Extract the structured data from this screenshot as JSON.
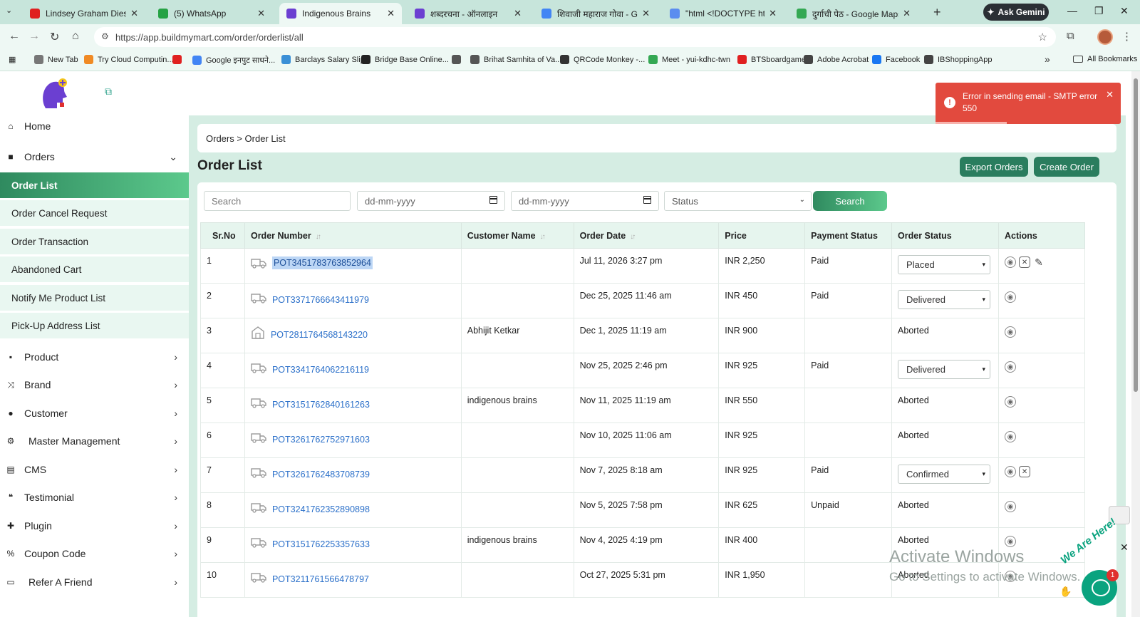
{
  "browser": {
    "tabs": [
      {
        "title": "Lindsey Graham Dies Hours",
        "favicon_color": "#e02020"
      },
      {
        "title": "(5) WhatsApp",
        "favicon_color": "#25a244"
      },
      {
        "title": "Indigenous Brains",
        "favicon_color": "#6b3fd1"
      },
      {
        "title": "शब्दरचना - ऑनलाइन",
        "favicon_color": "#6b3fd1"
      },
      {
        "title": "शिवाजी महाराज गोवा - Googl",
        "favicon_color": "#4285f4"
      },
      {
        "title": "\"html <!DOCTYPE html><",
        "favicon_color": "#5b8def"
      },
      {
        "title": "दुर्गाची पेठ - Google Maps",
        "favicon_color": "#34a853"
      }
    ],
    "ask_gemini": "Ask Gemini",
    "url": "https://app.buildmymart.com/order/orderlist/all",
    "bookmarks": [
      {
        "label": "New Tab",
        "color": "#777777"
      },
      {
        "label": "Try Cloud Computin...",
        "color": "#f08a24"
      },
      {
        "label": "",
        "color": "#e02020"
      },
      {
        "label": "Google इनपुट साधने...",
        "color": "#4285f4"
      },
      {
        "label": "Barclays Salary Slip",
        "color": "#3a8fd6"
      },
      {
        "label": "Bridge Base Online...",
        "color": "#222222"
      },
      {
        "label": "",
        "color": "#555555"
      },
      {
        "label": "Brihat Samhita of Va...",
        "color": "#555555"
      },
      {
        "label": "QRCode Monkey -...",
        "color": "#333333"
      },
      {
        "label": "Meet - yui-kdhc-twn",
        "color": "#34a853"
      },
      {
        "label": "BTSboardgame",
        "color": "#e02020"
      },
      {
        "label": "Adobe Acrobat",
        "color": "#444444"
      },
      {
        "label": "Facebook",
        "color": "#1877f2"
      },
      {
        "label": "IBShoppingApp",
        "color": "#444444"
      }
    ],
    "all_bookmarks": "All Bookmarks"
  },
  "sidebar": {
    "home": "Home",
    "orders": "Orders",
    "order_subitems": [
      "Order List",
      "Order Cancel Request",
      "Order Transaction",
      "Abandoned Cart",
      "Notify Me Product List",
      "Pick-Up Address List"
    ],
    "sections": [
      {
        "label": "Product",
        "icon": "box-icon"
      },
      {
        "label": "Brand",
        "icon": "shuffle-icon"
      },
      {
        "label": "Customer",
        "icon": "user-icon"
      },
      {
        "label": "Master Management",
        "icon": "user-gear-icon"
      },
      {
        "label": "CMS",
        "icon": "file-icon"
      },
      {
        "label": "Testimonial",
        "icon": "quote-icon"
      },
      {
        "label": "Plugin",
        "icon": "puzzle-icon"
      },
      {
        "label": "Coupon Code",
        "icon": "percent-icon"
      },
      {
        "label": "Refer A Friend",
        "icon": "ticket-icon"
      }
    ]
  },
  "main": {
    "breadcrumb": "Orders > Order List",
    "title": "Order List",
    "export_button": "Export Orders",
    "create_button": "Create Order",
    "filters": {
      "search_placeholder": "Search",
      "date_from_placeholder": "dd-mm-yyyy",
      "date_to_placeholder": "dd-mm-yyyy",
      "status_placeholder": "Status",
      "search_button": "Search"
    },
    "table": {
      "headers": [
        "Sr.No",
        "Order Number",
        "Customer Name",
        "Order Date",
        "Price",
        "Payment Status",
        "Order Status",
        "Actions"
      ],
      "rows": [
        {
          "sr": "1",
          "order_no": "POT3451783763852964",
          "customer": "",
          "date": "Jul 11, 2026 3:27 pm",
          "price": "INR 2,250",
          "payment": "Paid",
          "status": "Placed",
          "status_type": "select",
          "actions": [
            "view",
            "cancel",
            "edit"
          ],
          "selected": true,
          "pickup": false
        },
        {
          "sr": "2",
          "order_no": "POT3371766643411979",
          "customer": "",
          "date": "Dec 25, 2025 11:46 am",
          "price": "INR 450",
          "payment": "Paid",
          "status": "Delivered",
          "status_type": "select",
          "actions": [
            "view"
          ],
          "pickup": false
        },
        {
          "sr": "3",
          "order_no": "POT2811764568143220",
          "customer": "Abhijit Ketkar",
          "date": "Dec 1, 2025 11:19 am",
          "price": "INR 900",
          "payment": "",
          "status": "Aborted",
          "status_type": "text",
          "actions": [
            "view"
          ],
          "pickup": true
        },
        {
          "sr": "4",
          "order_no": "POT3341764062216119",
          "customer": "",
          "date": "Nov 25, 2025 2:46 pm",
          "price": "INR 925",
          "payment": "Paid",
          "status": "Delivered",
          "status_type": "select",
          "actions": [
            "view"
          ],
          "pickup": false
        },
        {
          "sr": "5",
          "order_no": "POT3151762840161263",
          "customer": "indigenous brains",
          "date": "Nov 11, 2025 11:19 am",
          "price": "INR 550",
          "payment": "",
          "status": "Aborted",
          "status_type": "text",
          "actions": [
            "view"
          ],
          "pickup": false
        },
        {
          "sr": "6",
          "order_no": "POT3261762752971603",
          "customer": "",
          "date": "Nov 10, 2025 11:06 am",
          "price": "INR 925",
          "payment": "",
          "status": "Aborted",
          "status_type": "text",
          "actions": [
            "view"
          ],
          "pickup": false
        },
        {
          "sr": "7",
          "order_no": "POT3261762483708739",
          "customer": "",
          "date": "Nov 7, 2025 8:18 am",
          "price": "INR 925",
          "payment": "Paid",
          "status": "Confirmed",
          "status_type": "select",
          "actions": [
            "view",
            "cancel"
          ],
          "pickup": false
        },
        {
          "sr": "8",
          "order_no": "POT3241762352890898",
          "customer": "",
          "date": "Nov 5, 2025 7:58 pm",
          "price": "INR 625",
          "payment": "Unpaid",
          "status": "Aborted",
          "status_type": "text",
          "actions": [
            "view"
          ],
          "pickup": false
        },
        {
          "sr": "9",
          "order_no": "POT3151762253357633",
          "customer": "indigenous brains",
          "date": "Nov 4, 2025 4:19 pm",
          "price": "INR 400",
          "payment": "",
          "status": "Aborted",
          "status_type": "text",
          "actions": [
            "view"
          ],
          "pickup": false
        },
        {
          "sr": "10",
          "order_no": "POT3211761566478797",
          "customer": "",
          "date": "Oct 27, 2025 5:31 pm",
          "price": "INR 1,950",
          "payment": "",
          "status": "Aborted",
          "status_type": "text",
          "actions": [
            "view"
          ],
          "pickup": false
        }
      ]
    }
  },
  "toast": {
    "message": "Error in sending email - SMTP error 550",
    "color": "#e24a3e"
  },
  "watermark": {
    "line1": "Activate Windows",
    "line2": "Go to Settings to activate Windows."
  },
  "chat": {
    "badge": "1",
    "tagline": "We Are Here!"
  },
  "colors": {
    "accent": "#2a7d5e",
    "accent_light": "#5cc98c",
    "content_bg": "#d5ede3",
    "link": "#2a6fc9"
  }
}
